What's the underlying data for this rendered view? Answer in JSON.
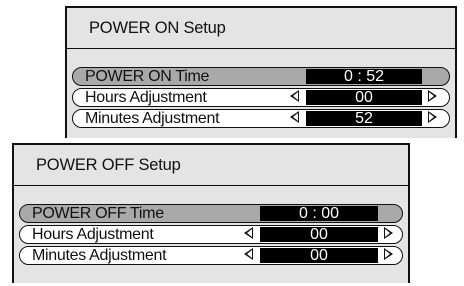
{
  "power_on": {
    "title": "POWER ON Setup",
    "time_label": "POWER ON Time",
    "time_value": "0 : 52",
    "hours_label": "Hours Adjustment",
    "hours_value": "00",
    "minutes_label": "Minutes Adjustment",
    "minutes_value": "52"
  },
  "power_off": {
    "title": "POWER OFF Setup",
    "time_label": "POWER OFF Time",
    "time_value": "0 : 00",
    "hours_label": "Hours Adjustment",
    "hours_value": "00",
    "minutes_label": "Minutes Adjustment",
    "minutes_value": "00"
  },
  "icons": {
    "decrease": "triangle-left-icon",
    "increase": "triangle-right-icon"
  },
  "colors": {
    "panel_background": "#e4e4e4",
    "selected_row": "#a9a9a9",
    "value_box": "#000000",
    "value_text": "#ffffff"
  }
}
